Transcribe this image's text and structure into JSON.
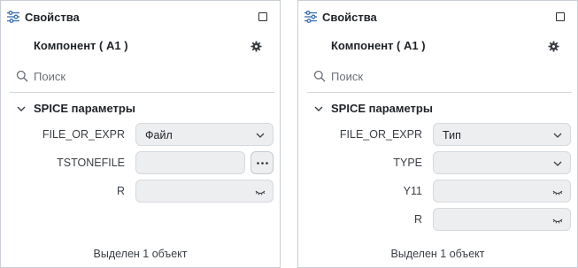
{
  "panels": [
    {
      "title": "Свойства",
      "component": "Компонент ( A1 )",
      "search_placeholder": "Поиск",
      "section": "SPICE параметры",
      "rows": [
        {
          "label": "FILE_OR_EXPR",
          "type": "select",
          "value": "Файл"
        },
        {
          "label": "TSTONEFILE",
          "type": "browse",
          "value": ""
        },
        {
          "label": "R",
          "type": "hidden",
          "value": ""
        }
      ],
      "status": "Выделен 1 объект"
    },
    {
      "title": "Свойства",
      "component": "Компонент ( A1 )",
      "search_placeholder": "Поиск",
      "section": "SPICE параметры",
      "rows": [
        {
          "label": "FILE_OR_EXPR",
          "type": "select",
          "value": "Тип"
        },
        {
          "label": "TYPE",
          "type": "select",
          "value": ""
        },
        {
          "label": "Y11",
          "type": "hidden",
          "value": ""
        },
        {
          "label": "R",
          "type": "hidden",
          "value": ""
        }
      ],
      "status": "Выделен 1 объект"
    }
  ],
  "icons": {
    "header": "sliders-icon",
    "checkbox": "square-icon",
    "component": "gear-icon",
    "search": "search-icon",
    "section": "chevron-down-icon",
    "select": "chevron-down-icon",
    "hidden": "eye-closed-icon",
    "browse": "ellipsis-icon"
  }
}
